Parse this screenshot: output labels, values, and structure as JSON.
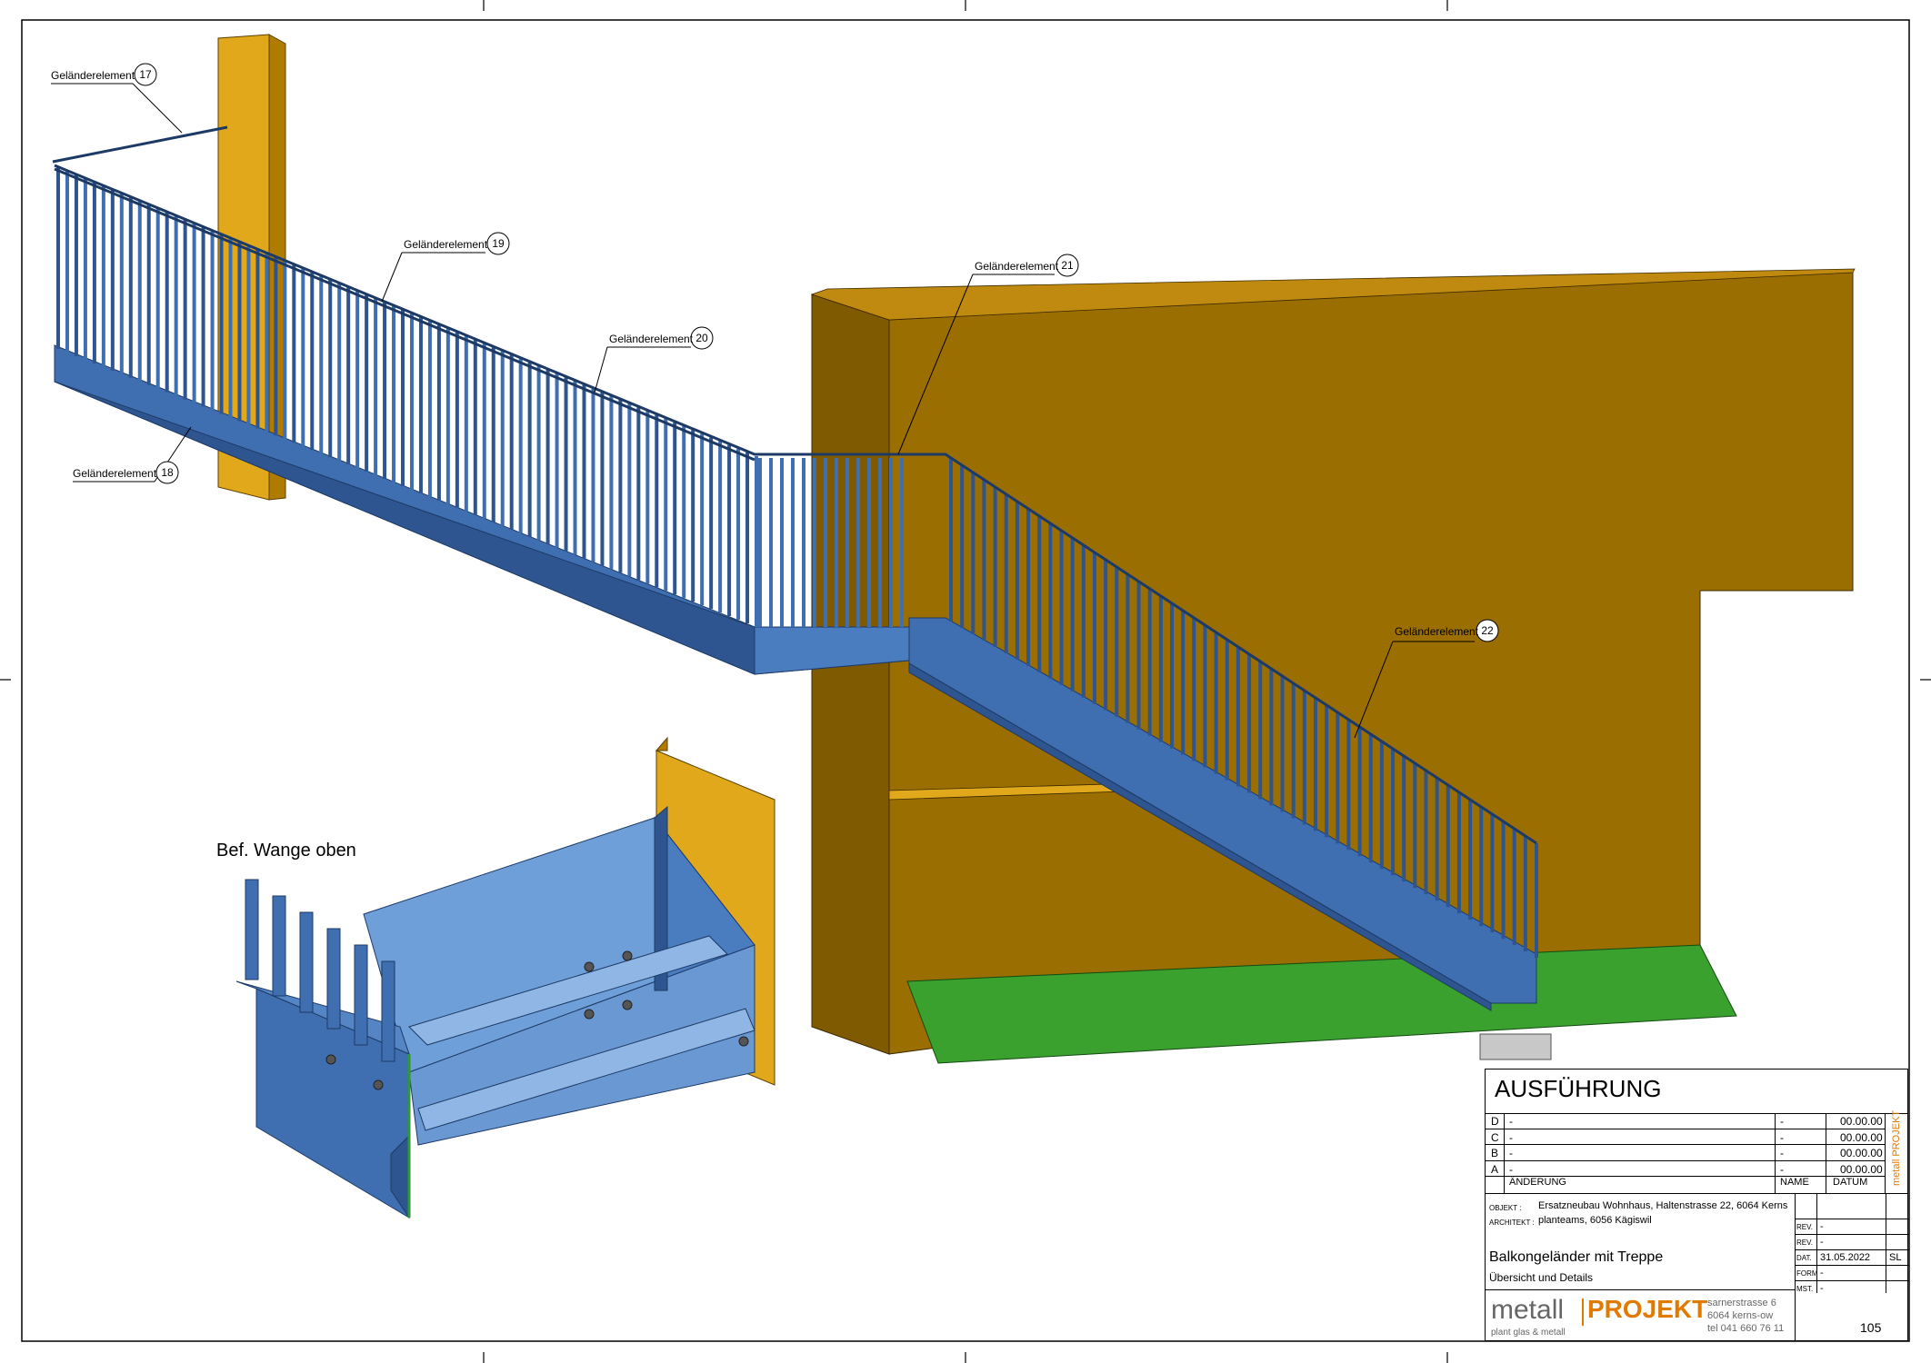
{
  "callouts": [
    {
      "text": "Geländerelement",
      "number": "17"
    },
    {
      "text": "Geländerelement",
      "number": "19"
    },
    {
      "text": "Geländerelement",
      "number": "20"
    },
    {
      "text": "Geländerelement",
      "number": "18"
    },
    {
      "text": "Geländerelement",
      "number": "21"
    },
    {
      "text": "Geländerelement",
      "number": "22"
    }
  ],
  "detail_title": "Bef. Wange oben",
  "colors": {
    "steel": "#3f6fb0",
    "steel_dark": "#2e5590",
    "wall": "#9a6e00",
    "post": "#e0a81a",
    "floor": "#3aa02e"
  },
  "titleblock": {
    "status": "AUSFÜHRUNG",
    "revisions": [
      {
        "rev": "D",
        "desc": "-",
        "name": "-",
        "date": "00.00.00"
      },
      {
        "rev": "C",
        "desc": "-",
        "name": "-",
        "date": "00.00.00"
      },
      {
        "rev": "B",
        "desc": "-",
        "name": "-",
        "date": "00.00.00"
      },
      {
        "rev": "A",
        "desc": "-",
        "name": "-",
        "date": "00.00.00"
      }
    ],
    "rev_headers": {
      "change": "ÄNDERUNG",
      "name": "NAME",
      "date": "DATUM"
    },
    "side_brand": "metall PROJEKT",
    "objekt_label": "OBJEKT :",
    "objekt_value": "Ersatzneubau Wohnhaus, Haltenstrasse 22, 6064 Kerns",
    "architekt_label": "ARCHITEKT :",
    "architekt_value": "planteams, 6056 Kägiswil",
    "meta": [
      {
        "label": "REV.",
        "value": "-",
        "extra": ""
      },
      {
        "label": "REV.",
        "value": "-",
        "extra": ""
      },
      {
        "label": "DAT.",
        "value": "31.05.2022",
        "extra": "SL"
      },
      {
        "label": "FORM",
        "value": "-",
        "extra": ""
      },
      {
        "label": "MST.",
        "value": "-",
        "extra": ""
      }
    ],
    "drawing_title": "Balkongeländer mit Treppe",
    "drawing_subtitle": "Übersicht und Details",
    "logo_left": "metall",
    "logo_right": "PROJEKT",
    "logo_tagline": "plant glas & metall",
    "address": [
      "sarnerstrasse 6",
      "6064 kerns-ow",
      "tel 041 660 76 11"
    ],
    "sheet_number": "105"
  }
}
